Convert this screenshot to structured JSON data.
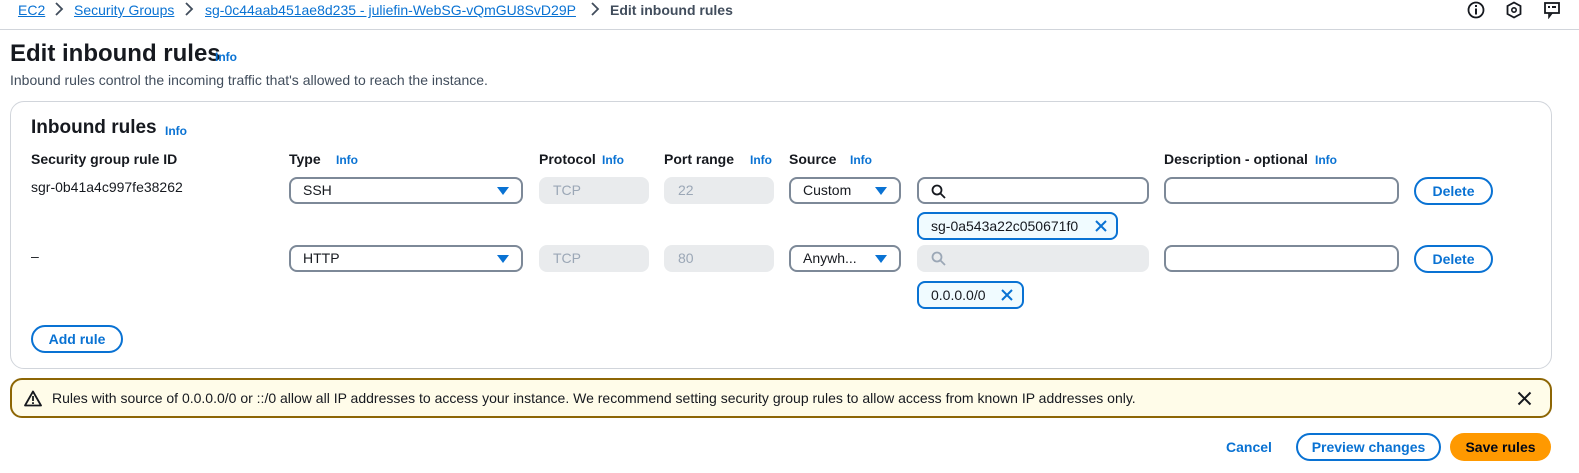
{
  "breadcrumb": {
    "items": [
      "EC2",
      "Security Groups",
      "sg-0c44aab451ae8d235 - juliefin-WebSG-vQmGU8SvD29P"
    ],
    "current": "Edit inbound rules"
  },
  "top_icons": [
    "info-circle-icon",
    "shield-icon",
    "feedback-icon"
  ],
  "page": {
    "title": "Edit inbound rules",
    "info": "Info",
    "description": "Inbound rules control the incoming traffic that's allowed to reach the instance."
  },
  "inbound": {
    "title": "Inbound rules",
    "info": "Info",
    "columns": {
      "rule_id": "Security group rule ID",
      "type": "Type",
      "protocol": "Protocol",
      "port_range": "Port range",
      "source": "Source",
      "description": "Description - optional",
      "info": "Info"
    },
    "rules": [
      {
        "rule_id": "sgr-0b41a4c997fe38262",
        "type": "SSH",
        "protocol": "TCP",
        "port_range": "22",
        "source": "Custom",
        "source_search": "",
        "source_token": "sg-0a543a22c050671f0",
        "description": "",
        "delete_label": "Delete"
      },
      {
        "rule_id": "–",
        "type": "HTTP",
        "protocol": "TCP",
        "port_range": "80",
        "source": "Anywh...",
        "source_search": "",
        "source_token": "0.0.0.0/0",
        "description": "",
        "delete_label": "Delete"
      }
    ],
    "add_rule_label": "Add rule"
  },
  "warning": {
    "text": "Rules with source of 0.0.0.0/0 or ::/0 allow all IP addresses to access your instance. We recommend setting security group rules to allow access from known IP addresses only."
  },
  "footer": {
    "cancel_label": "Cancel",
    "preview_label": "Preview changes",
    "save_label": "Save rules"
  },
  "colors": {
    "link": "#0972d3",
    "primary_button": "#ff9900",
    "warning_border": "#8d6605",
    "warning_bg": "#fffce9"
  }
}
